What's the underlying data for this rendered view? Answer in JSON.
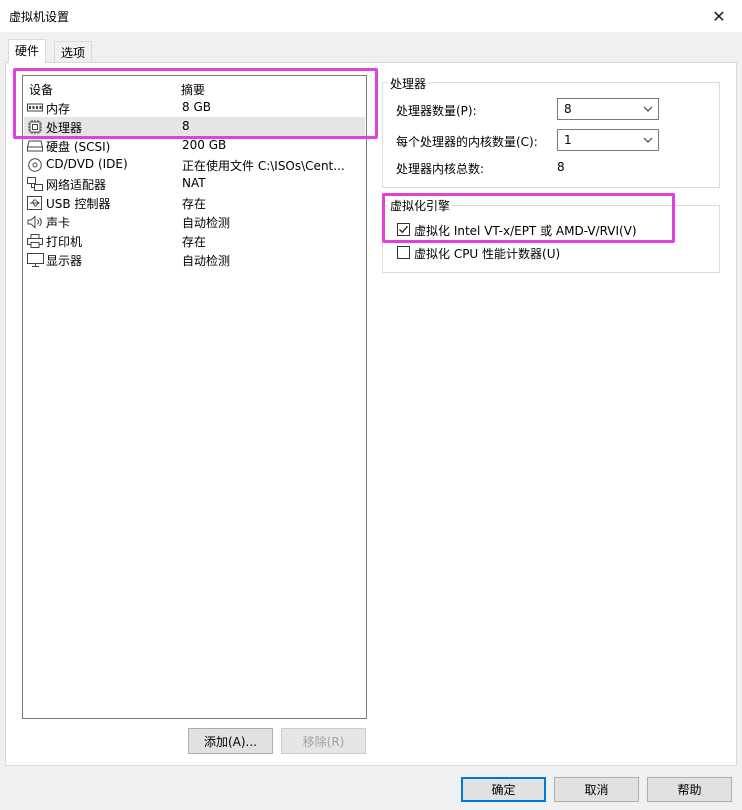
{
  "window": {
    "title": "虚拟机设置",
    "close_glyph": "✕"
  },
  "tabs": [
    {
      "label": "硬件",
      "active": true
    },
    {
      "label": "选项",
      "active": false
    }
  ],
  "device_list": {
    "col_device": "设备",
    "col_summary": "摘要",
    "rows": [
      {
        "icon": "memory-icon",
        "name": "内存",
        "summary": "8 GB",
        "selected": false
      },
      {
        "icon": "processor-icon",
        "name": "处理器",
        "summary": "8",
        "selected": true
      },
      {
        "icon": "hard-disk-icon",
        "name": "硬盘 (SCSI)",
        "summary": "200 GB",
        "selected": false
      },
      {
        "icon": "cd-dvd-icon",
        "name": "CD/DVD (IDE)",
        "summary": "正在使用文件 C:\\ISOs\\Cent...",
        "selected": false
      },
      {
        "icon": "network-adapter-icon",
        "name": "网络适配器",
        "summary": "NAT",
        "selected": false
      },
      {
        "icon": "usb-icon",
        "name": "USB 控制器",
        "summary": "存在",
        "selected": false
      },
      {
        "icon": "speaker-icon",
        "name": "声卡",
        "summary": "自动检测",
        "selected": false
      },
      {
        "icon": "printer-icon",
        "name": "打印机",
        "summary": "存在",
        "selected": false
      },
      {
        "icon": "monitor-icon",
        "name": "显示器",
        "summary": "自动检测",
        "selected": false
      }
    ]
  },
  "list_buttons": {
    "add": "添加(A)...",
    "remove": "移除(R)"
  },
  "processor": {
    "group_title": "处理器",
    "count_label": "处理器数量(P):",
    "count_value": "8",
    "cores_label": "每个处理器的内核数量(C):",
    "cores_value": "1",
    "total_label": "处理器内核总数:",
    "total_value": "8"
  },
  "virtualization": {
    "group_title": "虚拟化引擎",
    "vtx_label": "虚拟化 Intel VT-x/EPT 或 AMD-V/RVI(V)",
    "vtx_checked": true,
    "cpu_counter_label": "虚拟化 CPU 性能计数器(U)",
    "cpu_counter_checked": false
  },
  "footer": {
    "ok": "确定",
    "cancel": "取消",
    "help": "帮助"
  },
  "colors": {
    "highlight": "#e040e0",
    "selected_row": "#e5e5e5",
    "accent": "#0078d7"
  }
}
